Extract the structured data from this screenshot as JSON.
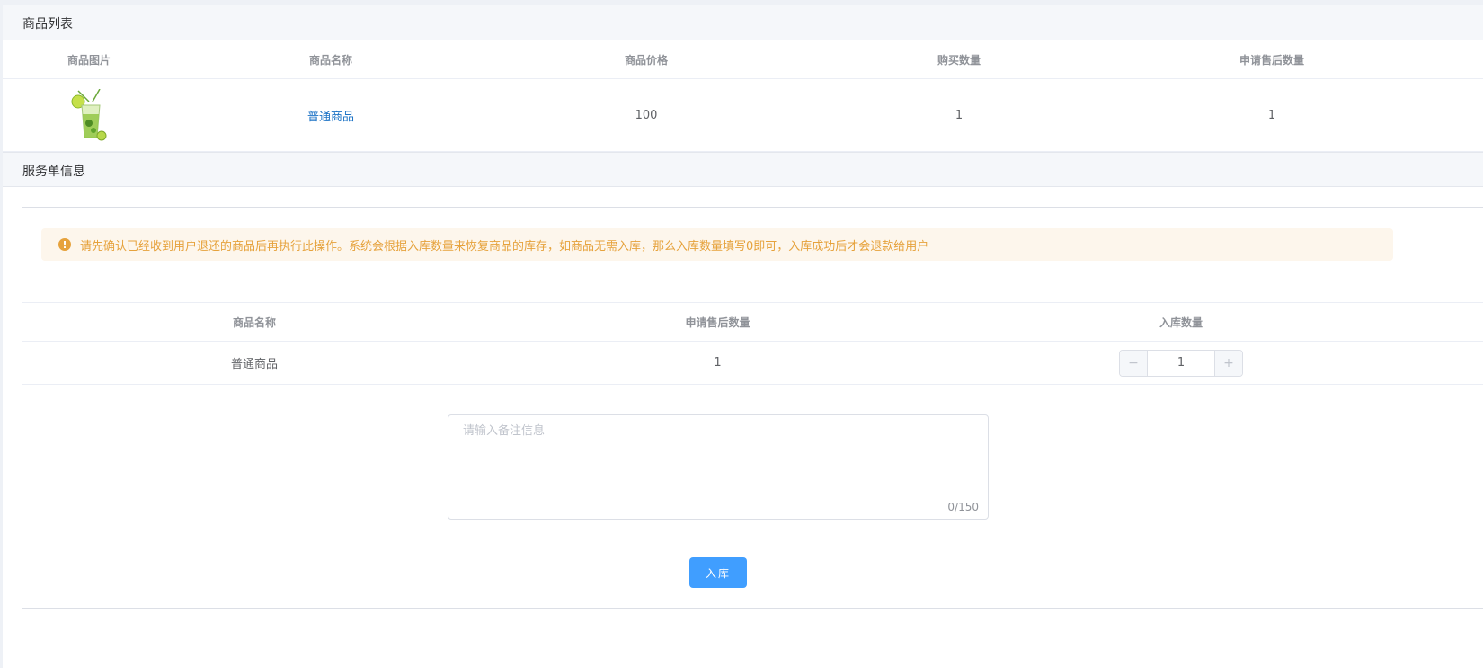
{
  "product_section": {
    "title": "商品列表",
    "columns": [
      "商品图片",
      "商品名称",
      "商品价格",
      "购买数量",
      "申请售后数量"
    ],
    "rows": [
      {
        "image_icon": "mojito-drink-icon",
        "name": "普通商品",
        "price": "100",
        "quantity": "1",
        "after_sale_quantity": "1"
      }
    ]
  },
  "service_section": {
    "title": "服务单信息",
    "alert": "请先确认已经收到用户退还的商品后再执行此操作。系统会根据入库数量来恢复商品的库存，如商品无需入库，那么入库数量填写0即可，入库成功后才会退款给用户",
    "columns": [
      "商品名称",
      "申请售后数量",
      "入库数量"
    ],
    "rows": [
      {
        "name": "普通商品",
        "after_sale_quantity": "1",
        "stock_in_quantity": "1"
      }
    ],
    "stepper": {
      "minus": "−",
      "plus": "+"
    },
    "remark": {
      "placeholder": "请输入备注信息",
      "counter": "0/150"
    },
    "submit_label": "入库"
  },
  "colors": {
    "primary": "#409eff",
    "link": "#1b72c5",
    "warning": "#e6a23c",
    "warning_bg": "#fdf6ec"
  }
}
